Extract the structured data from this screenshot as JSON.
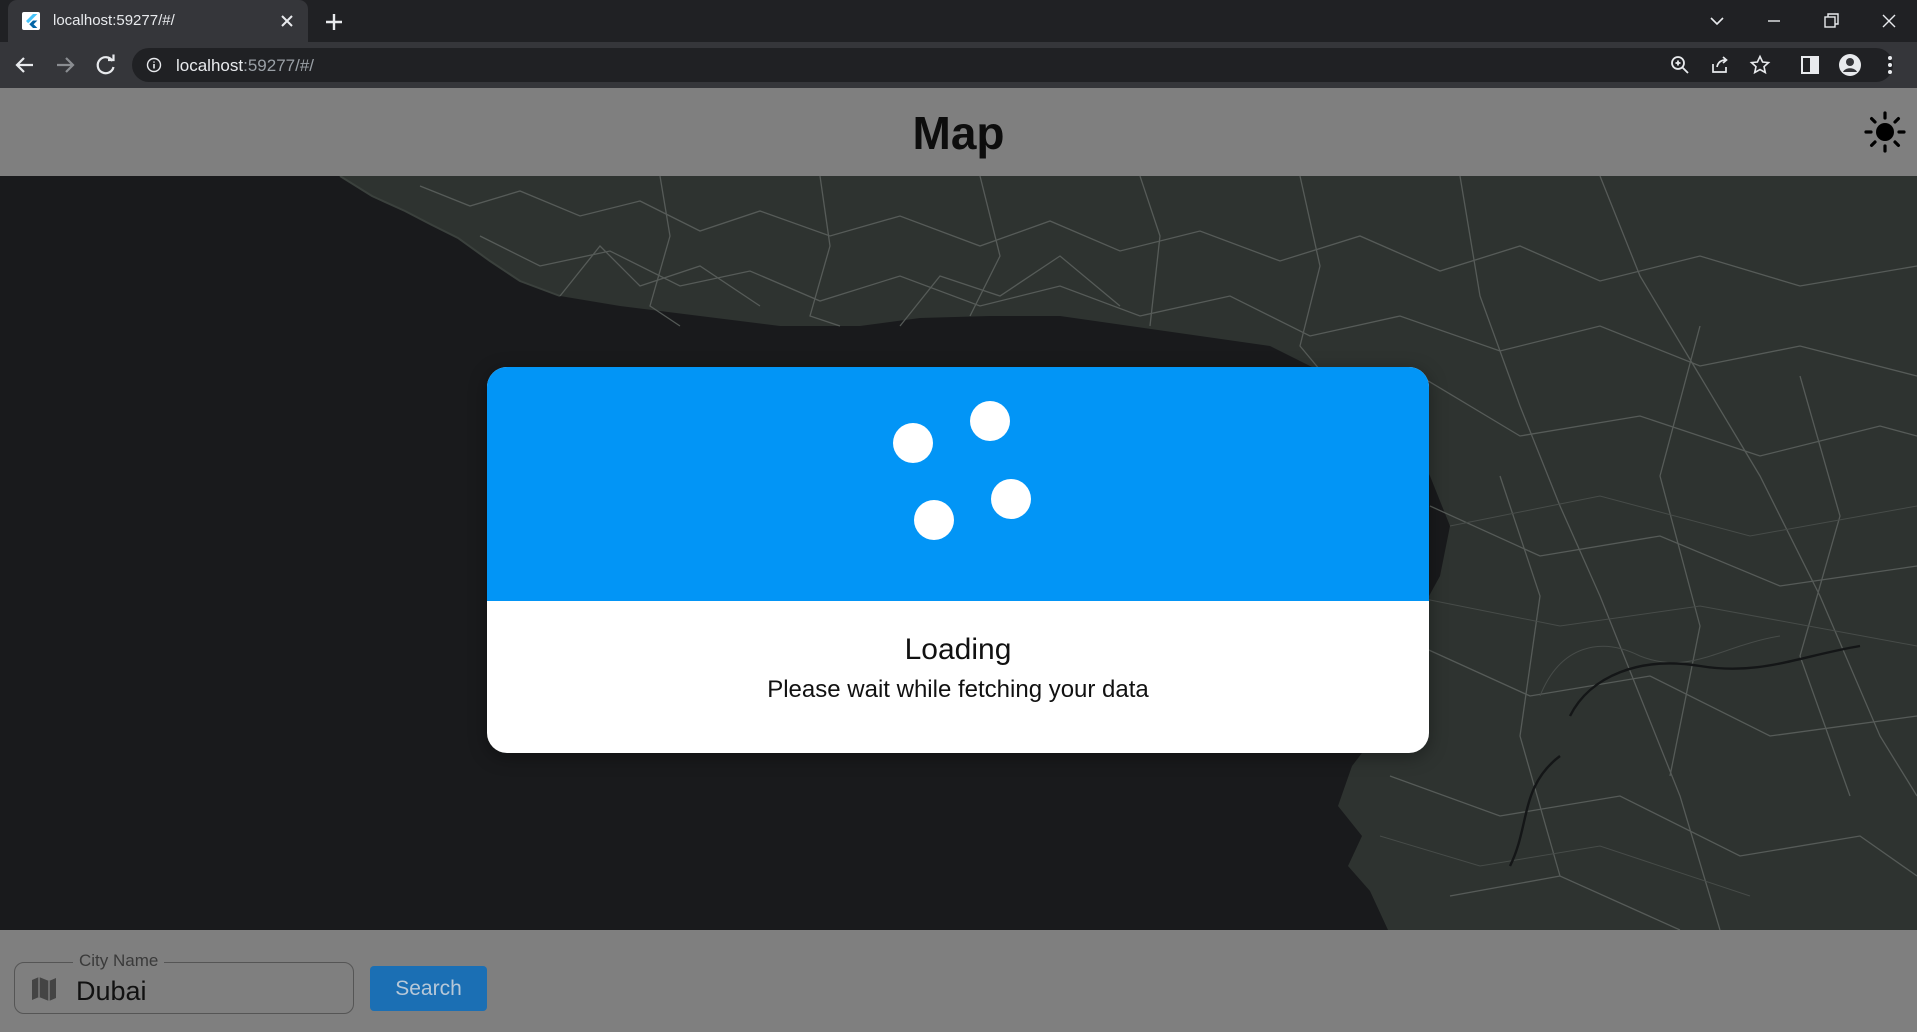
{
  "browser": {
    "tab_title": "localhost:59277/#/",
    "url_host": "localhost",
    "url_rest": ":59277/#/",
    "icons": [
      "flutter-favicon-icon",
      "close-icon",
      "plus-icon",
      "chevron-down-icon",
      "minimize-icon",
      "restore-icon",
      "window-close-icon",
      "back-arrow-icon",
      "forward-arrow-icon",
      "reload-icon",
      "info-icon",
      "zoom-icon",
      "share-icon",
      "star-icon",
      "side-panel-icon",
      "profile-icon",
      "kebab-menu-icon"
    ]
  },
  "app": {
    "title": "Map",
    "theme_icon": "sun-icon"
  },
  "dialog": {
    "title": "Loading",
    "message": "Please wait while fetching your data",
    "accent_color": "#0295f6"
  },
  "search": {
    "label": "City Name",
    "value": "Dubai",
    "icon": "map-icon",
    "button_label": "Search"
  },
  "colors": {
    "appbar": "#7f7f7f",
    "map_land": "#2e3330",
    "map_sea": "#191a1c",
    "button": "#1b6fb4"
  }
}
